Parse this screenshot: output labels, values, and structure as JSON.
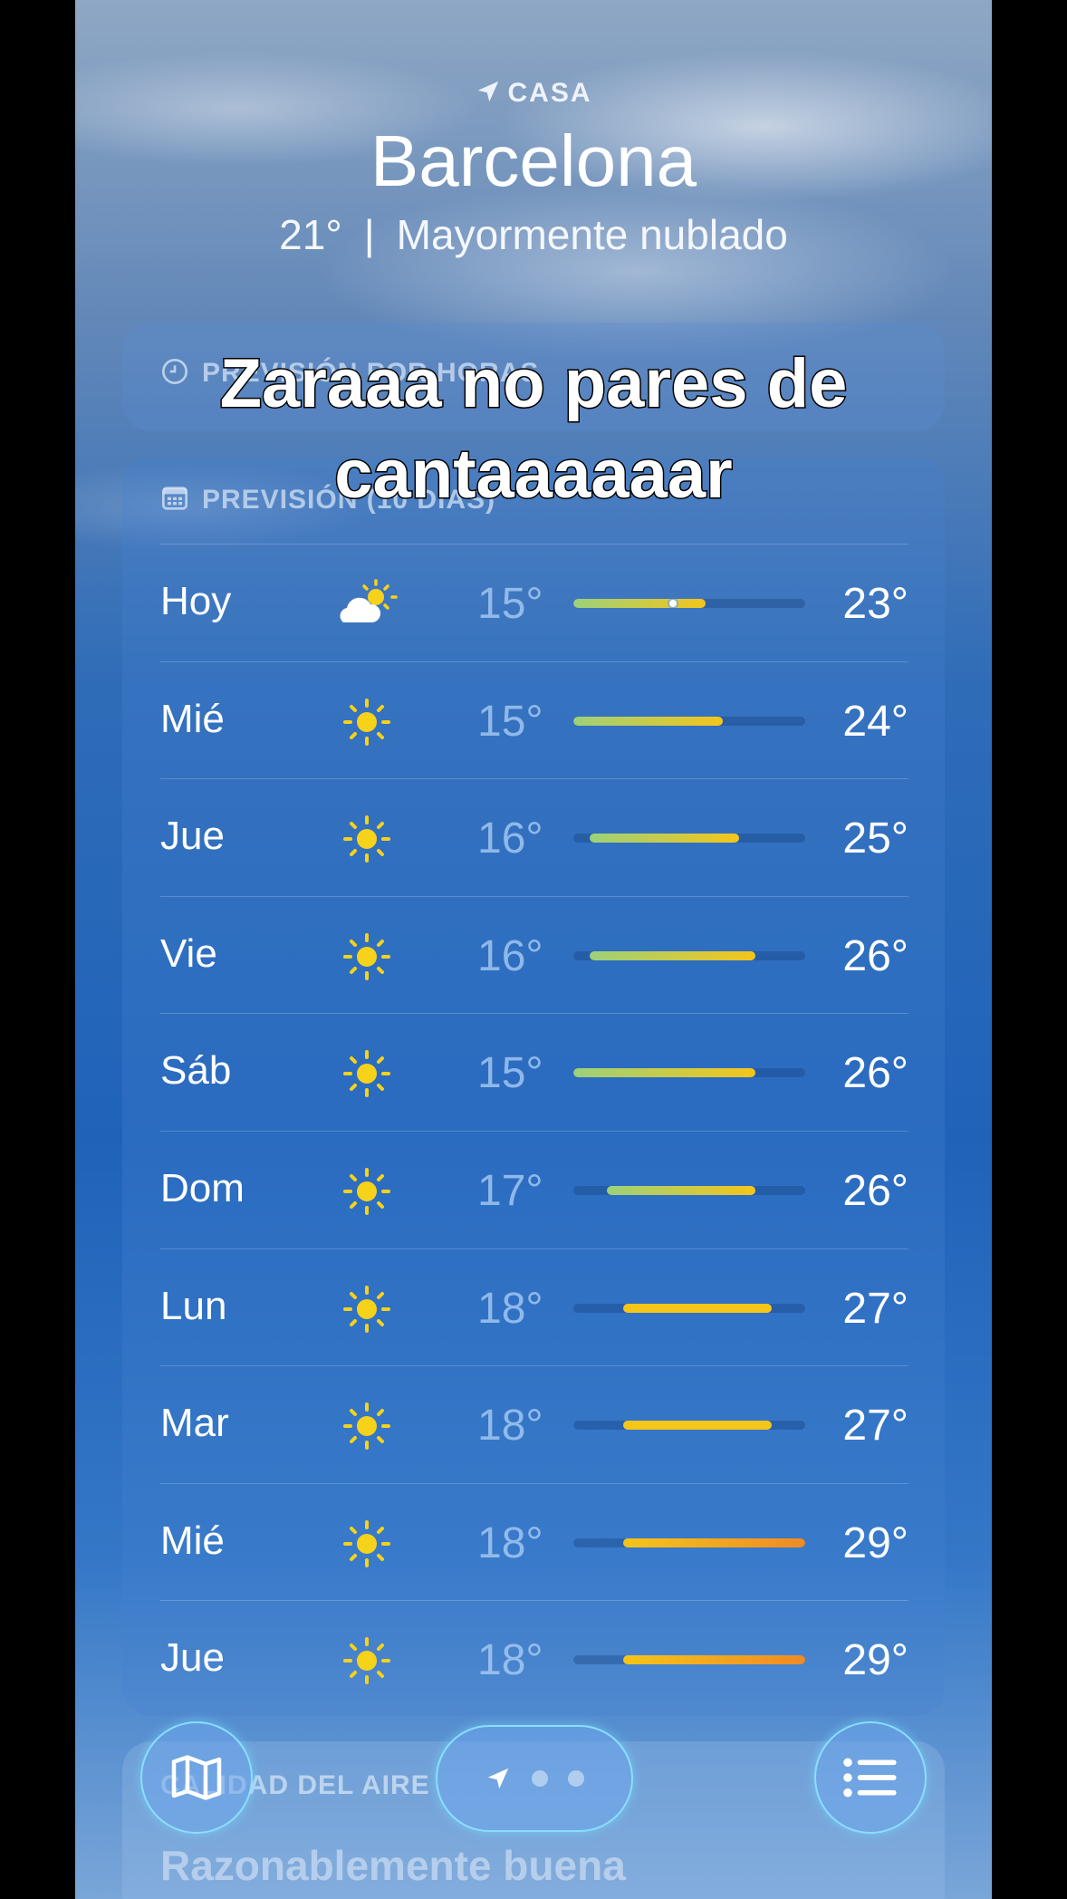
{
  "header": {
    "location_label": "CASA",
    "city": "Barcelona",
    "current_temp": "21°",
    "separator": "|",
    "condition": "Mayormente nublado"
  },
  "hourly_card": {
    "title": "PREVISIÓN POR HORAS",
    "icon": "clock-icon"
  },
  "daily_card": {
    "title": "PREVISIÓN (10 DÍAS)",
    "icon": "calendar-icon",
    "range_min": 15,
    "range_max": 29,
    "current_temp_value": 21,
    "days": [
      {
        "day": "Hoy",
        "icon": "partly-cloudy-sun-icon",
        "low": "15°",
        "high": "23°",
        "low_v": 15,
        "high_v": 23
      },
      {
        "day": "Mié",
        "icon": "sun-icon",
        "low": "15°",
        "high": "24°",
        "low_v": 15,
        "high_v": 24
      },
      {
        "day": "Jue",
        "icon": "sun-icon",
        "low": "16°",
        "high": "25°",
        "low_v": 16,
        "high_v": 25
      },
      {
        "day": "Vie",
        "icon": "sun-icon",
        "low": "16°",
        "high": "26°",
        "low_v": 16,
        "high_v": 26
      },
      {
        "day": "Sáb",
        "icon": "sun-icon",
        "low": "15°",
        "high": "26°",
        "low_v": 15,
        "high_v": 26
      },
      {
        "day": "Dom",
        "icon": "sun-icon",
        "low": "17°",
        "high": "26°",
        "low_v": 17,
        "high_v": 26
      },
      {
        "day": "Lun",
        "icon": "sun-icon",
        "low": "18°",
        "high": "27°",
        "low_v": 18,
        "high_v": 27
      },
      {
        "day": "Mar",
        "icon": "sun-icon",
        "low": "18°",
        "high": "27°",
        "low_v": 18,
        "high_v": 27
      },
      {
        "day": "Mié",
        "icon": "sun-icon",
        "low": "18°",
        "high": "29°",
        "low_v": 18,
        "high_v": 29
      },
      {
        "day": "Jue",
        "icon": "sun-icon",
        "low": "18°",
        "high": "29°",
        "low_v": 18,
        "high_v": 29
      }
    ]
  },
  "air_quality_card": {
    "title": "CALIDAD DEL AIRE",
    "value": "Razonablemente buena"
  },
  "caption": {
    "line1": "Zaraaa no pares de",
    "line2": "cantaaaaaar"
  },
  "bottom_bar": {
    "map_icon": "map-icon",
    "location_icon": "location-arrow-icon",
    "list_icon": "list-icon",
    "page_count": 3
  },
  "colors": {
    "sun": "#f7d21a",
    "cool": "#9cd17a",
    "warm": "#f5c51a",
    "hot": "#f08a24"
  }
}
